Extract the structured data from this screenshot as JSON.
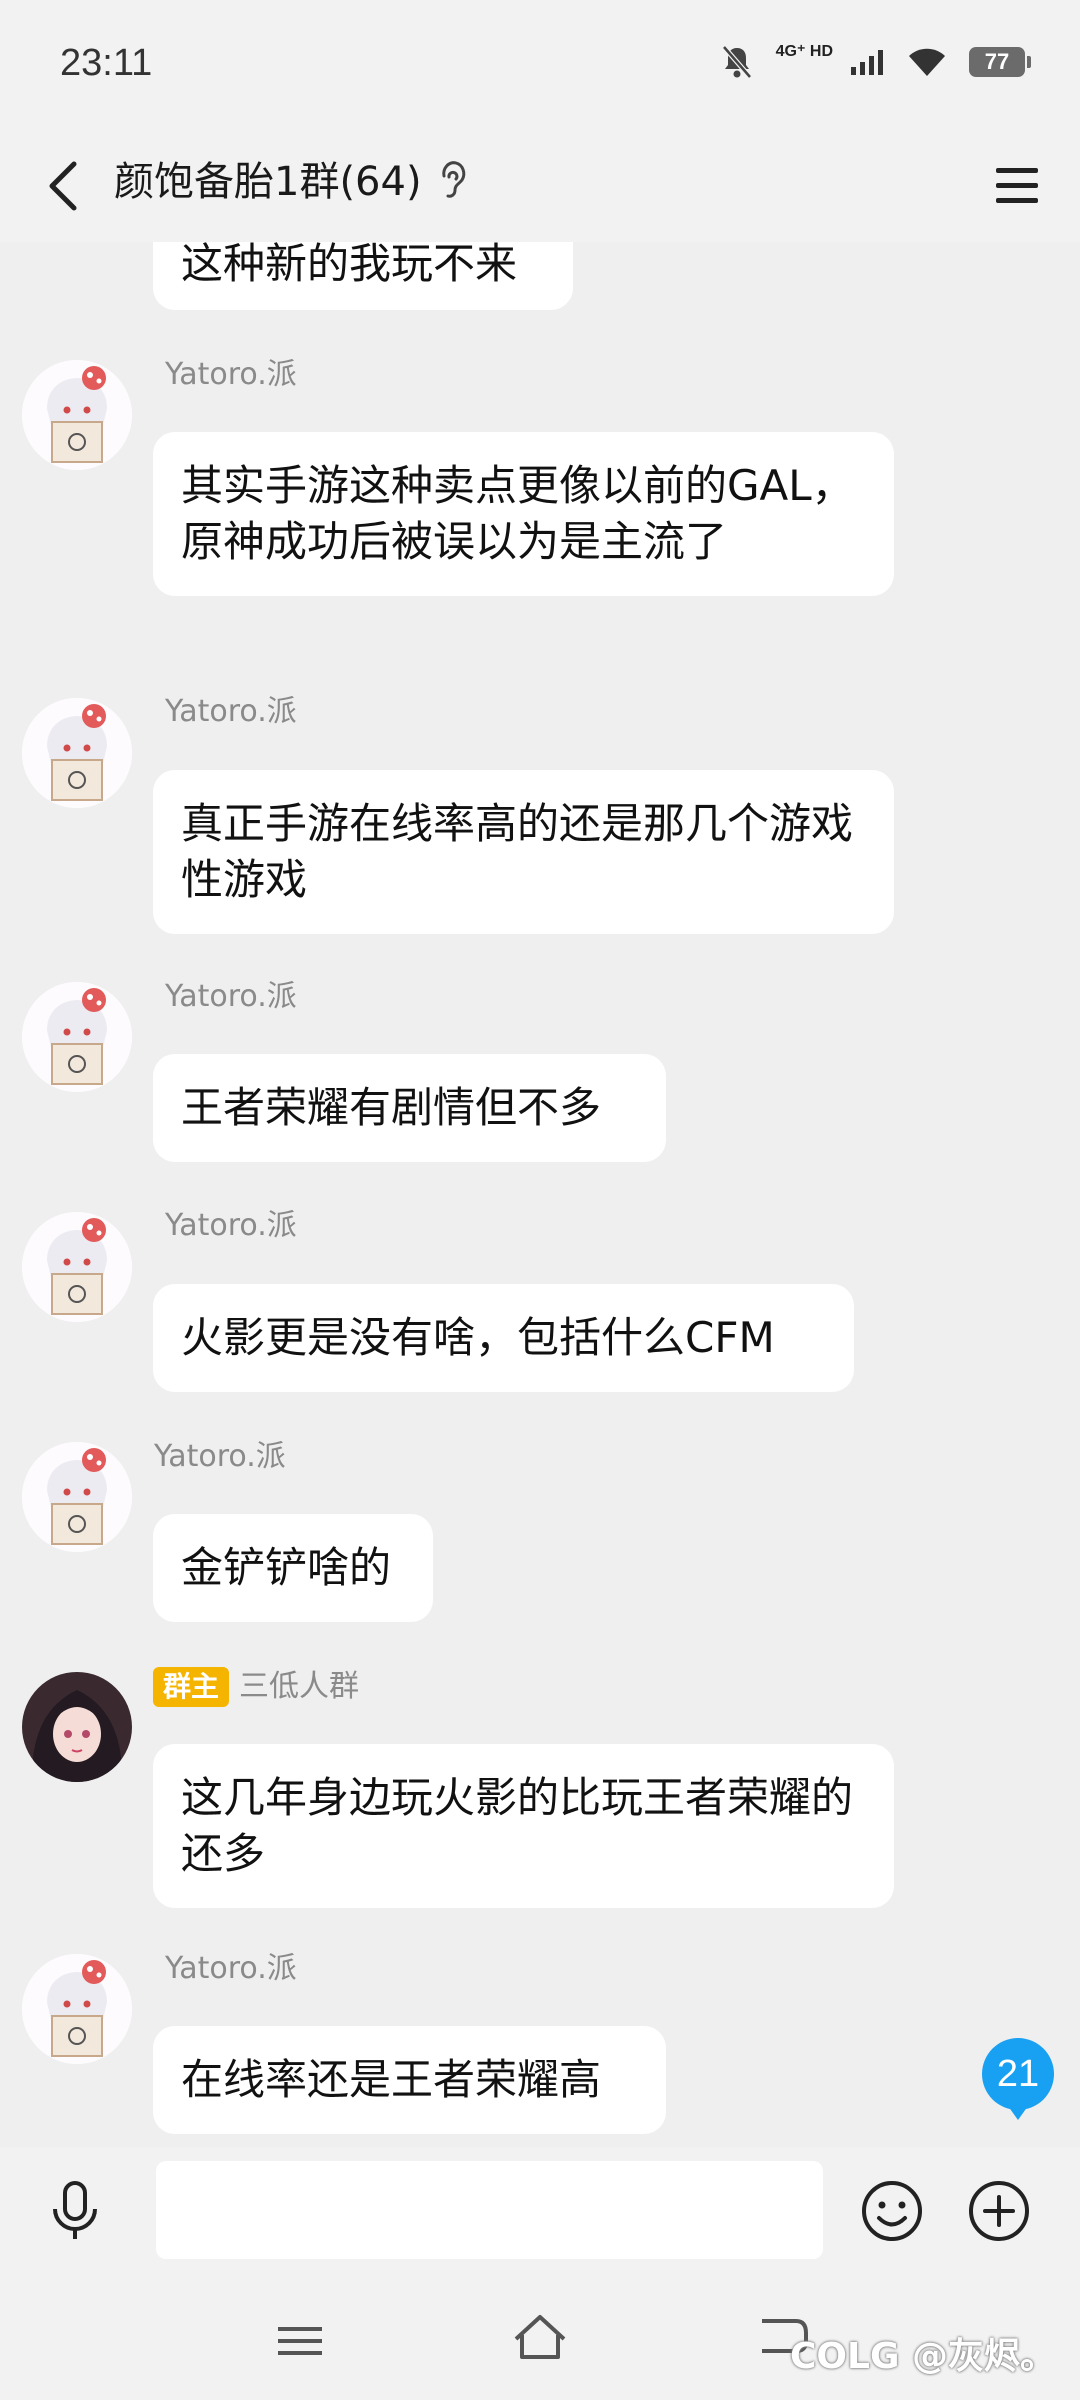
{
  "status_bar": {
    "time": "23:11",
    "network": "4G⁺ HD",
    "battery": "77"
  },
  "header": {
    "title": "颜饱备胎1群(64)"
  },
  "messages": [
    {
      "sender": "",
      "text": "这种新的我玩不来"
    },
    {
      "sender": "Yatoro.派",
      "text": "其实手游这种卖点更像以前的GAL，原神成功后被误以为是主流了"
    },
    {
      "sender": "Yatoro.派",
      "text": "真正手游在线率高的还是那几个游戏性游戏"
    },
    {
      "sender": "Yatoro.派",
      "text": "王者荣耀有剧情但不多"
    },
    {
      "sender": "Yatoro.派",
      "text": "火影更是没有啥，包括什么CFM"
    },
    {
      "sender": "Yatoro.派",
      "text": "金铲铲啥的"
    },
    {
      "sender": "三低人群",
      "badge": "群主",
      "text": "这几年身边玩火影的比玩王者荣耀的还多"
    },
    {
      "sender": "Yatoro.派",
      "text": "在线率还是王者荣耀高"
    }
  ],
  "unread_count": "21",
  "input": {
    "placeholder": ""
  },
  "watermark": "COLG @灰烬。",
  "colors": {
    "badge": "#f5b400",
    "unread": "#18a0f2",
    "background": "#efefef"
  }
}
